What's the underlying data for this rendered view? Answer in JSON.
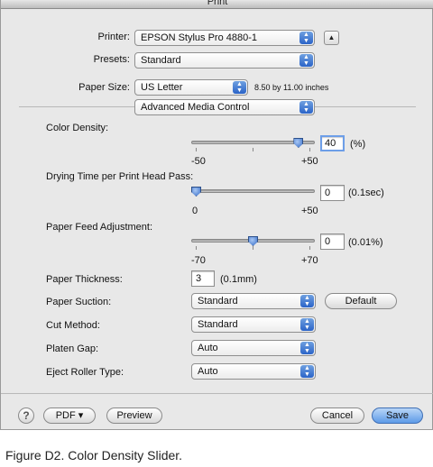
{
  "window": {
    "title": "Print"
  },
  "printer": {
    "label": "Printer:",
    "value": "EPSON Stylus Pro 4880-1",
    "disclosure": "▲"
  },
  "presets": {
    "label": "Presets:",
    "value": "Standard"
  },
  "paper_size": {
    "label": "Paper Size:",
    "value": "US Letter",
    "dimensions": "8.50 by 11.00 inches"
  },
  "panel_menu": {
    "value": "Advanced Media Control"
  },
  "color_density": {
    "label": "Color Density:",
    "value": "40",
    "unit": "(%)",
    "min_label": "-50",
    "max_label": "+50",
    "min": -50,
    "max": 50,
    "current": 40
  },
  "drying_time": {
    "label": "Drying Time per Print Head Pass:",
    "value": "0",
    "unit": "(0.1sec)",
    "min_label": "0",
    "max_label": "+50",
    "min": 0,
    "max": 50,
    "current": 0
  },
  "paper_feed": {
    "label": "Paper Feed Adjustment:",
    "value": "0",
    "unit": "(0.01%)",
    "min_label": "-70",
    "max_label": "+70",
    "min": -70,
    "max": 70,
    "current": 0
  },
  "paper_thickness": {
    "label": "Paper Thickness:",
    "value": "3",
    "unit": "(0.1mm)"
  },
  "paper_suction": {
    "label": "Paper Suction:",
    "value": "Standard",
    "default_button": "Default"
  },
  "cut_method": {
    "label": "Cut Method:",
    "value": "Standard"
  },
  "platen_gap": {
    "label": "Platen Gap:",
    "value": "Auto"
  },
  "eject_roller": {
    "label": "Eject Roller Type:",
    "value": "Auto"
  },
  "footer": {
    "help": "?",
    "pdf_button": "PDF ▾",
    "preview_button": "Preview",
    "cancel_button": "Cancel",
    "save_button": "Save"
  },
  "caption": "Figure D2. Color Density Slider.",
  "icons": {
    "popup_arrows": "updown-arrows-icon",
    "slider_thumb": "slider-thumb-icon",
    "help": "help-icon"
  }
}
